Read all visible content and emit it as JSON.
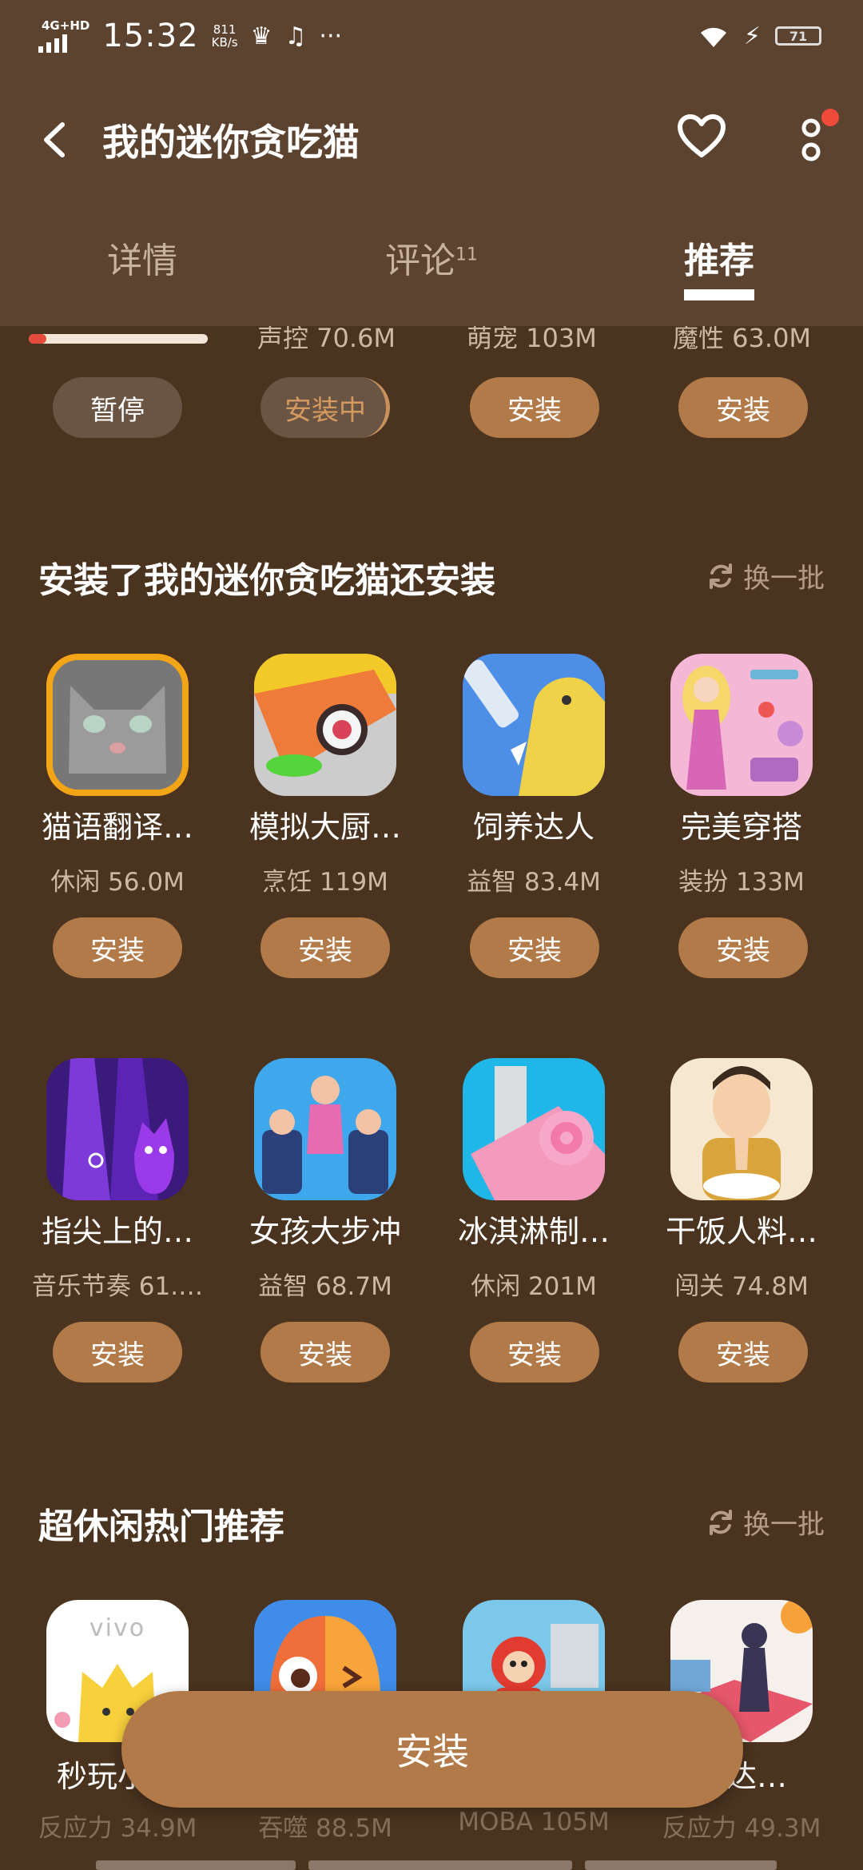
{
  "status_bar": {
    "network": "4G+HD",
    "time": "15:32",
    "speed_value": "811",
    "speed_unit": "KB/s",
    "more": "···",
    "battery": "71"
  },
  "header": {
    "title": "我的迷你贪吃猫",
    "tabs": [
      {
        "label": "详情",
        "badge": ""
      },
      {
        "label": "评论",
        "badge": "11"
      },
      {
        "label": "推荐",
        "badge": ""
      }
    ],
    "active_tab": "推荐"
  },
  "top_row": {
    "download_progress": 0.1,
    "metas": [
      "声控 70.6M",
      "萌宠 103M",
      "魔性 63.0M"
    ],
    "buttons": [
      "暂停",
      "安装中",
      "安装",
      "安装"
    ]
  },
  "section1": {
    "title": "安装了我的迷你贪吃猫还安装",
    "refresh_label": "换一批",
    "apps": [
      {
        "name": "猫语翻译…",
        "meta": "休闲 56.0M",
        "button": "安装"
      },
      {
        "name": "模拟大厨…",
        "meta": "烹饪 119M",
        "button": "安装"
      },
      {
        "name": "饲养达人",
        "meta": "益智 83.4M",
        "button": "安装"
      },
      {
        "name": "完美穿搭",
        "meta": "装扮 133M",
        "button": "安装"
      },
      {
        "name": "指尖上的…",
        "meta": "音乐节奏 61.…",
        "button": "安装"
      },
      {
        "name": "女孩大步冲",
        "meta": "益智 68.7M",
        "button": "安装"
      },
      {
        "name": "冰淇淋制…",
        "meta": "休闲 201M",
        "button": "安装"
      },
      {
        "name": "干饭人料…",
        "meta": "闯关 74.8M",
        "button": "安装"
      }
    ]
  },
  "section2": {
    "title": "超休闲热门推荐",
    "refresh_label": "换一批",
    "apps": [
      {
        "name": "秒玩小…",
        "meta": "反应力 34.9M",
        "icon_text": "vivo"
      },
      {
        "name": "",
        "meta": "吞噬 88.5M",
        "icon_text": ""
      },
      {
        "name": "",
        "meta": "MOBA 105M",
        "icon_text": ""
      },
      {
        "name": "跳达…",
        "meta": "反应力 49.3M",
        "icon_text": ""
      }
    ]
  },
  "bottom_button": "安装"
}
